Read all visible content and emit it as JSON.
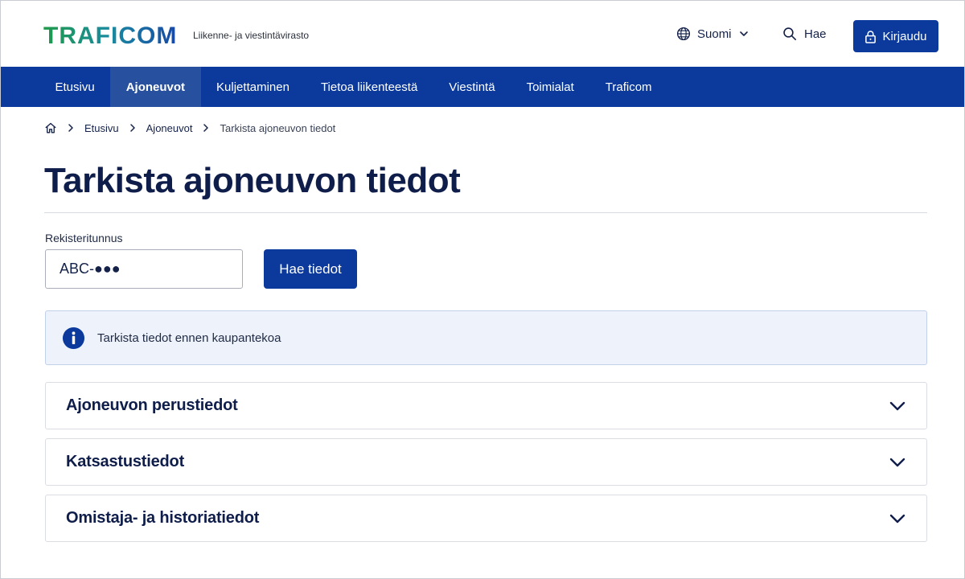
{
  "header": {
    "logo_text": "TRAFICOM",
    "tagline": "Liikenne- ja viestintävirasto",
    "language_label": "Suomi",
    "search_label": "Hae",
    "login_label": "Kirjaudu"
  },
  "nav": {
    "items": [
      {
        "label": "Etusivu",
        "active": false
      },
      {
        "label": "Ajoneuvot",
        "active": true
      },
      {
        "label": "Kuljettaminen",
        "active": false
      },
      {
        "label": "Tietoa liikenteestä",
        "active": false
      },
      {
        "label": "Viestintä",
        "active": false
      },
      {
        "label": "Toimialat",
        "active": false
      },
      {
        "label": "Traficom",
        "active": false
      }
    ]
  },
  "breadcrumb": {
    "items": [
      "Etusivu",
      "Ajoneuvot"
    ],
    "current": "Tarkista ajoneuvon tiedot"
  },
  "page": {
    "title": "Tarkista ajoneuvon tiedot"
  },
  "form": {
    "field_label": "Rekisteritunnus",
    "field_value": "ABC-●●●",
    "submit_label": "Hae tiedot"
  },
  "info": {
    "text": "Tarkista tiedot ennen kaupantekoa"
  },
  "accordions": [
    {
      "title": "Ajoneuvon perustiedot"
    },
    {
      "title": "Katsastustiedot"
    },
    {
      "title": "Omistaja- ja historiatiedot"
    }
  ],
  "colors": {
    "brand_blue": "#0b3a9c",
    "logo_green": "#1f9a4a",
    "logo_blue": "#1748a6",
    "title_navy": "#0f1d4a"
  },
  "icons": {
    "language": "globe-icon",
    "search": "search-icon",
    "login": "lock-icon",
    "home": "home-icon",
    "info": "info-icon",
    "expand": "chevron-down-icon"
  }
}
